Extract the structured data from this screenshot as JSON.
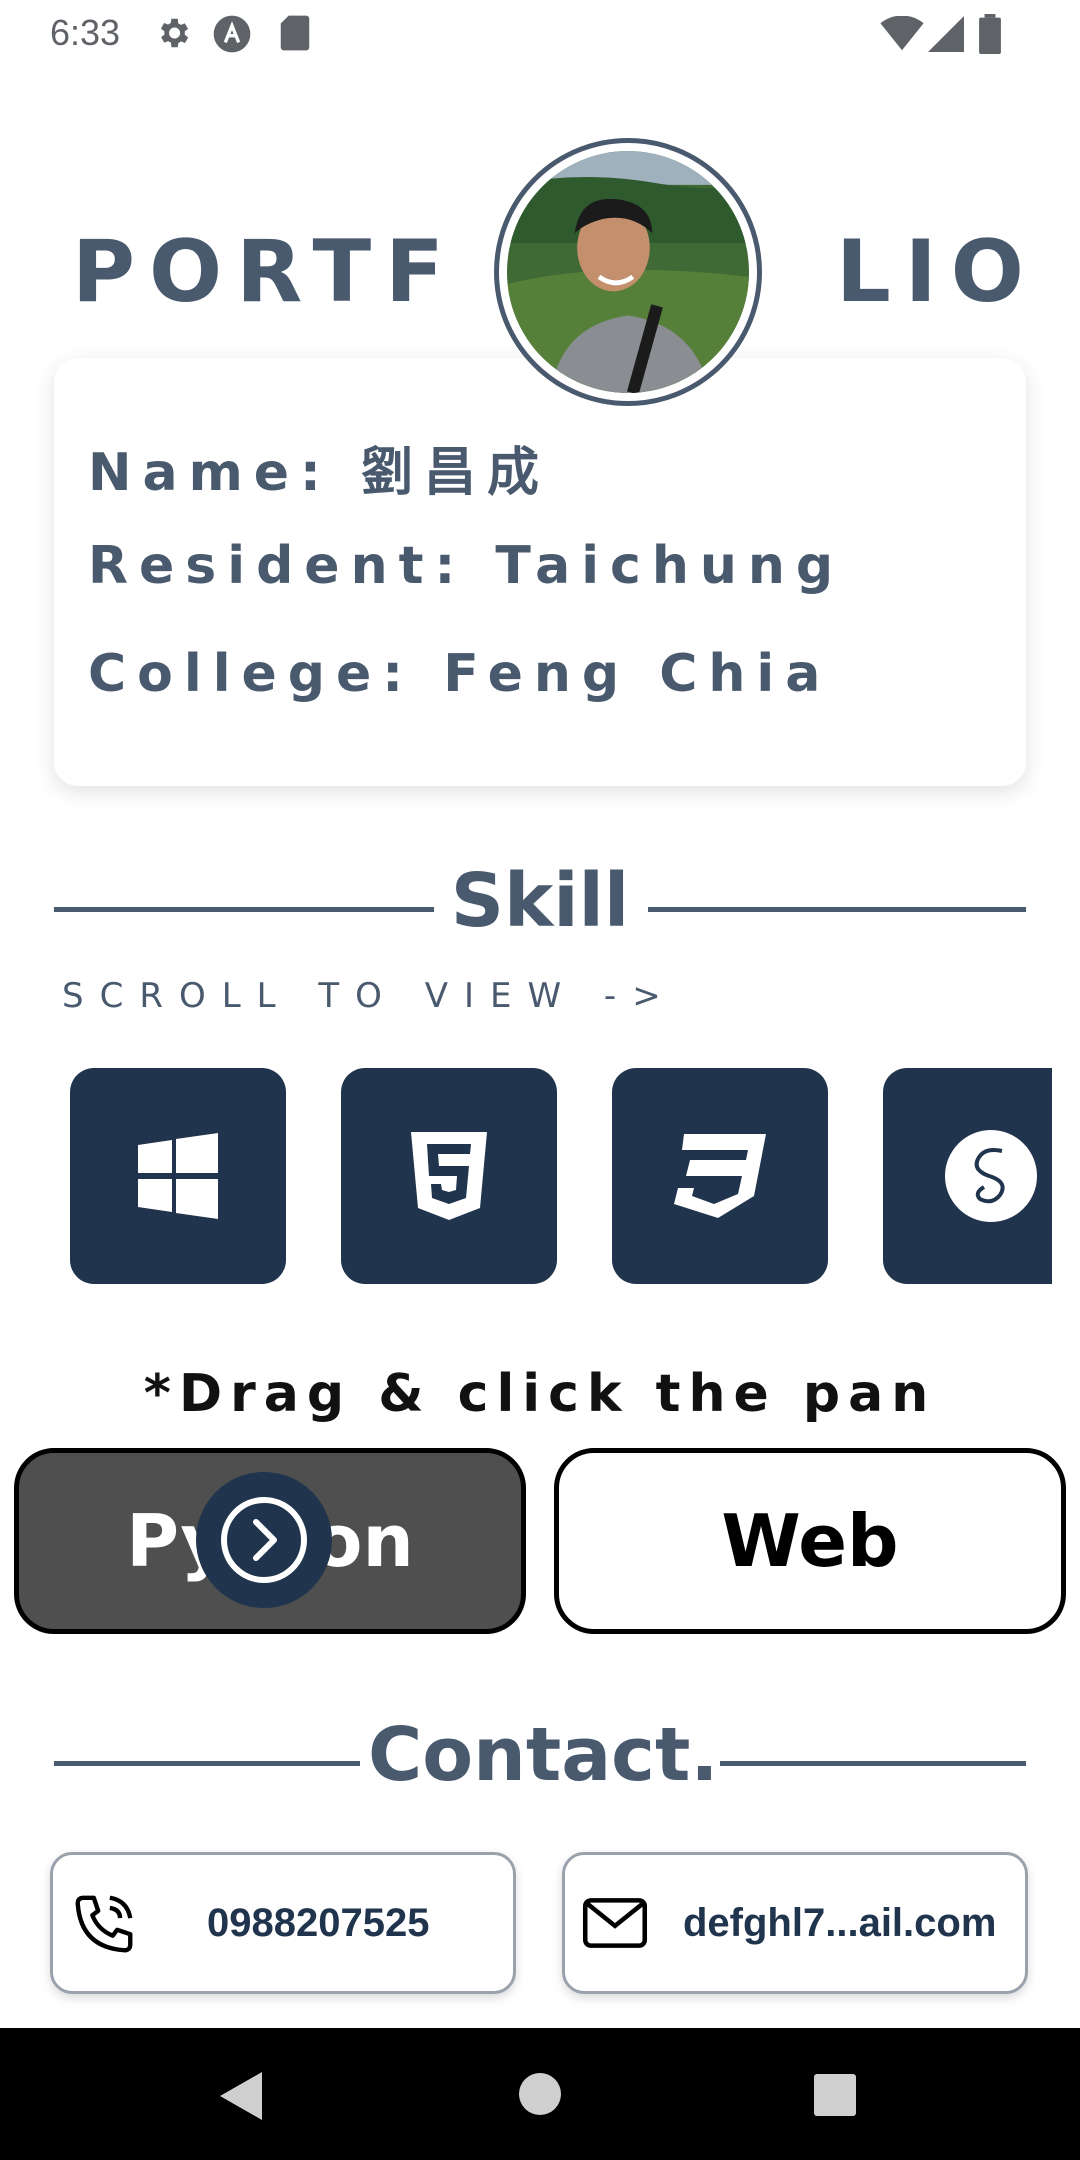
{
  "status_bar": {
    "time": "6:33",
    "left_icons": [
      "settings-icon",
      "accessibility-icon",
      "sd-card-icon"
    ],
    "right_icons": [
      "wifi-icon",
      "cell-signal-icon",
      "battery-icon"
    ]
  },
  "header": {
    "title_left": "PORTF",
    "title_right": "LIO",
    "avatar": "profile-photo"
  },
  "info": {
    "name": "Name: 劉昌成",
    "resident": "Resident: Taichung",
    "college": "College: Feng Chia"
  },
  "skill": {
    "title": "Skill",
    "hint": "SCROLL TO VIEW ->",
    "tiles": [
      "windows-icon",
      "html5-icon",
      "css3-icon",
      "sass-icon"
    ]
  },
  "pan": {
    "hint": "*Drag & click the pan",
    "python_label": "Python",
    "web_label": "Web",
    "fab_icon": "chevron-right-circle-icon"
  },
  "contact": {
    "title": "Contact.",
    "phone": "0988207525",
    "email": "defghl7...ail.com"
  },
  "colors": {
    "primary": "#20344d",
    "text": "#4a5a6e",
    "python_bg": "#4f4f4f"
  }
}
